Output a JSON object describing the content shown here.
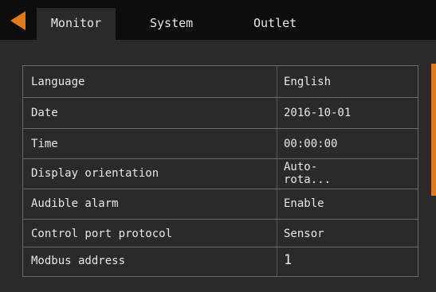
{
  "tabs": [
    {
      "label": "Monitor",
      "active": true
    },
    {
      "label": "System",
      "active": false
    },
    {
      "label": "Outlet",
      "active": false
    }
  ],
  "settings": [
    {
      "label": "Language",
      "value": "English"
    },
    {
      "label": "Date",
      "value": "2016-10-01"
    },
    {
      "label": "Time",
      "value": "00:00:00"
    },
    {
      "label": "Display orientation",
      "value": "Auto-rota..."
    },
    {
      "label": "Audible alarm",
      "value": "Enable"
    },
    {
      "label": "Control port protocol",
      "value": "Sensor"
    },
    {
      "label": "Modbus address",
      "value": "1"
    }
  ],
  "colors": {
    "background": "#2a2a2a",
    "top_bar": "#0d0d0d",
    "accent": "#e07a1e",
    "text": "#e8e8e8",
    "grid_line": "#6a6a6a"
  },
  "icons": {
    "back": "left-triangle-arrow"
  }
}
